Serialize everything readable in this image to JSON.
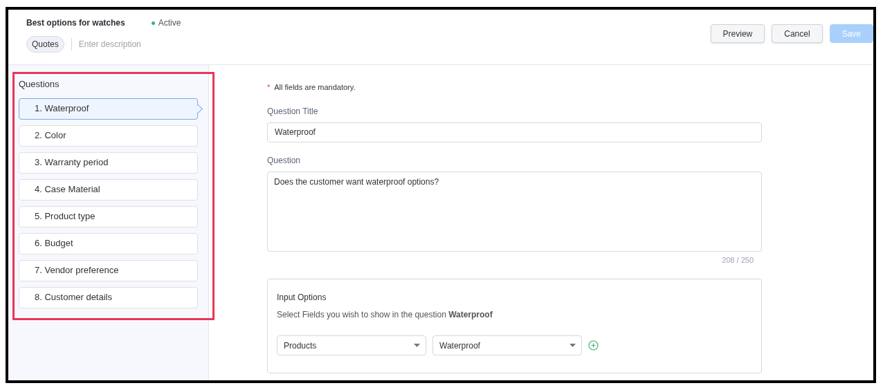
{
  "header": {
    "title": "Best options for watches",
    "status": {
      "label": "Active",
      "color": "#3cb371"
    },
    "tag": "Quotes",
    "description": {
      "placeholder": "Enter description"
    },
    "buttons": [
      {
        "label": "Preview",
        "kind": "secondary",
        "disabled": false
      },
      {
        "label": "Cancel",
        "kind": "secondary",
        "disabled": false
      },
      {
        "label": "Save",
        "kind": "primary",
        "disabled": true
      }
    ]
  },
  "sidebar": {
    "title": "Questions",
    "items": [
      {
        "label": "1. Waterproof",
        "selected": true
      },
      {
        "label": "2. Color",
        "selected": false
      },
      {
        "label": "3. Warranty period",
        "selected": false
      },
      {
        "label": "4. Case Material",
        "selected": false
      },
      {
        "label": "5. Product type",
        "selected": false
      },
      {
        "label": "6. Budget",
        "selected": false
      },
      {
        "label": "7. Vendor preference",
        "selected": false
      },
      {
        "label": "8. Customer details",
        "selected": false
      }
    ]
  },
  "form": {
    "mandatory_note": "All fields are mandatory.",
    "mandatory_mark": "*",
    "title_label": "Question Title",
    "title_value": "Waterproof",
    "question_label": "Question",
    "question_value": "Does the customer want waterproof options?",
    "counter": "208 / 250",
    "input_options": {
      "title": "Input Options",
      "hint": "Select Fields you wish to show in the question **Waterproof**",
      "selects": [
        "Products",
        "Waterproof"
      ]
    }
  }
}
